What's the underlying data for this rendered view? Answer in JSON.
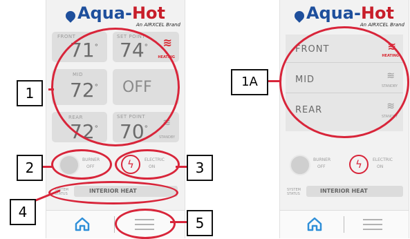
{
  "brand": {
    "name_blue": "Aqua-",
    "name_red": "Hot",
    "tagline": "An AIRXCEL Brand"
  },
  "left_screen": {
    "zones": [
      {
        "label": "FRONT",
        "current": "71",
        "set_label": "SET POINT",
        "setpoint": "74",
        "status": "HEATING"
      },
      {
        "label": "MID",
        "current": "72",
        "setpoint": "OFF"
      },
      {
        "label": "REAR",
        "current": "72",
        "set_label": "SET POINT",
        "setpoint": "70",
        "status": "STANDBY"
      }
    ],
    "burner": {
      "label": "BURNER",
      "state": "OFF"
    },
    "electric": {
      "label": "ELECTRIC",
      "state": "ON"
    },
    "system": {
      "label": "SYSTEM STATUS",
      "value": "INTERIOR HEAT"
    }
  },
  "right_screen": {
    "zones": [
      {
        "label": "FRONT",
        "status": "HEATING"
      },
      {
        "label": "MID",
        "status": "STANDBY"
      },
      {
        "label": "REAR",
        "status": "STANDBY"
      }
    ],
    "burner": {
      "label": "BURNER",
      "state": "OFF"
    },
    "electric": {
      "label": "ELECTRIC",
      "state": "ON"
    },
    "system": {
      "label": "SYSTEM STATUS",
      "value": "INTERIOR HEAT"
    }
  },
  "callouts": {
    "c1": "1",
    "c2": "2",
    "c3": "3",
    "c4": "4",
    "c5": "5",
    "c1a": "1A"
  },
  "colors": {
    "accent_red": "#d8253a",
    "brand_blue": "#1e4f9c"
  },
  "icons": [
    "home-icon",
    "menu-icon",
    "flame-icon",
    "bolt-icon",
    "heat-wave-icon"
  ]
}
